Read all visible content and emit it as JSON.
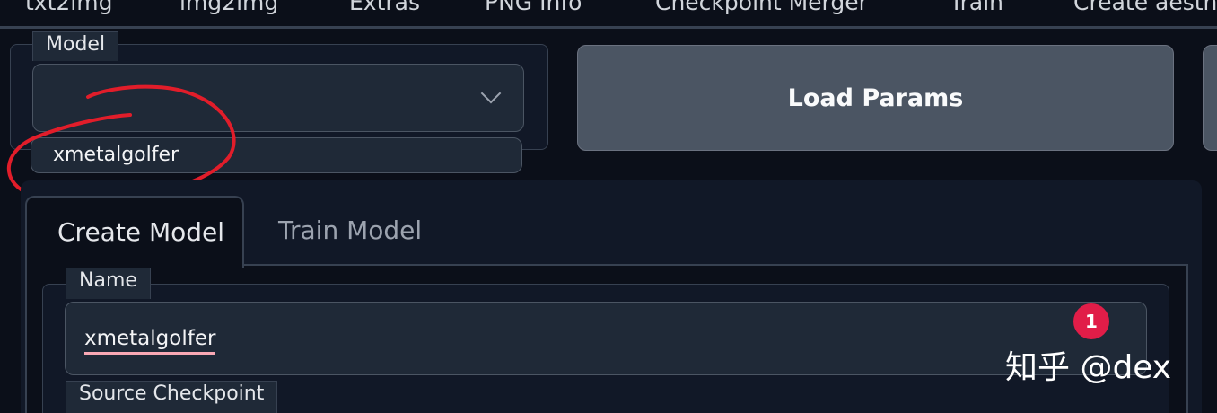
{
  "top_tabs": [
    "txt2img",
    "img2img",
    "Extras",
    "PNG Info",
    "Checkpoint Merger",
    "Train",
    "Create aesth"
  ],
  "model": {
    "label": "Model",
    "dropdown_value": "",
    "selected_text": "xmetalgolfer"
  },
  "buttons": {
    "load_params": "Load Params"
  },
  "tabs": {
    "create_model": "Create Model",
    "train_model": "Train Model"
  },
  "name_field": {
    "label": "Name",
    "value": "xmetalgolfer"
  },
  "source_checkpoint": {
    "label": "Source Checkpoint"
  },
  "overlay": {
    "badge": "1",
    "watermark": "知乎 @dex",
    "annotation_color": "#e11d2a"
  }
}
